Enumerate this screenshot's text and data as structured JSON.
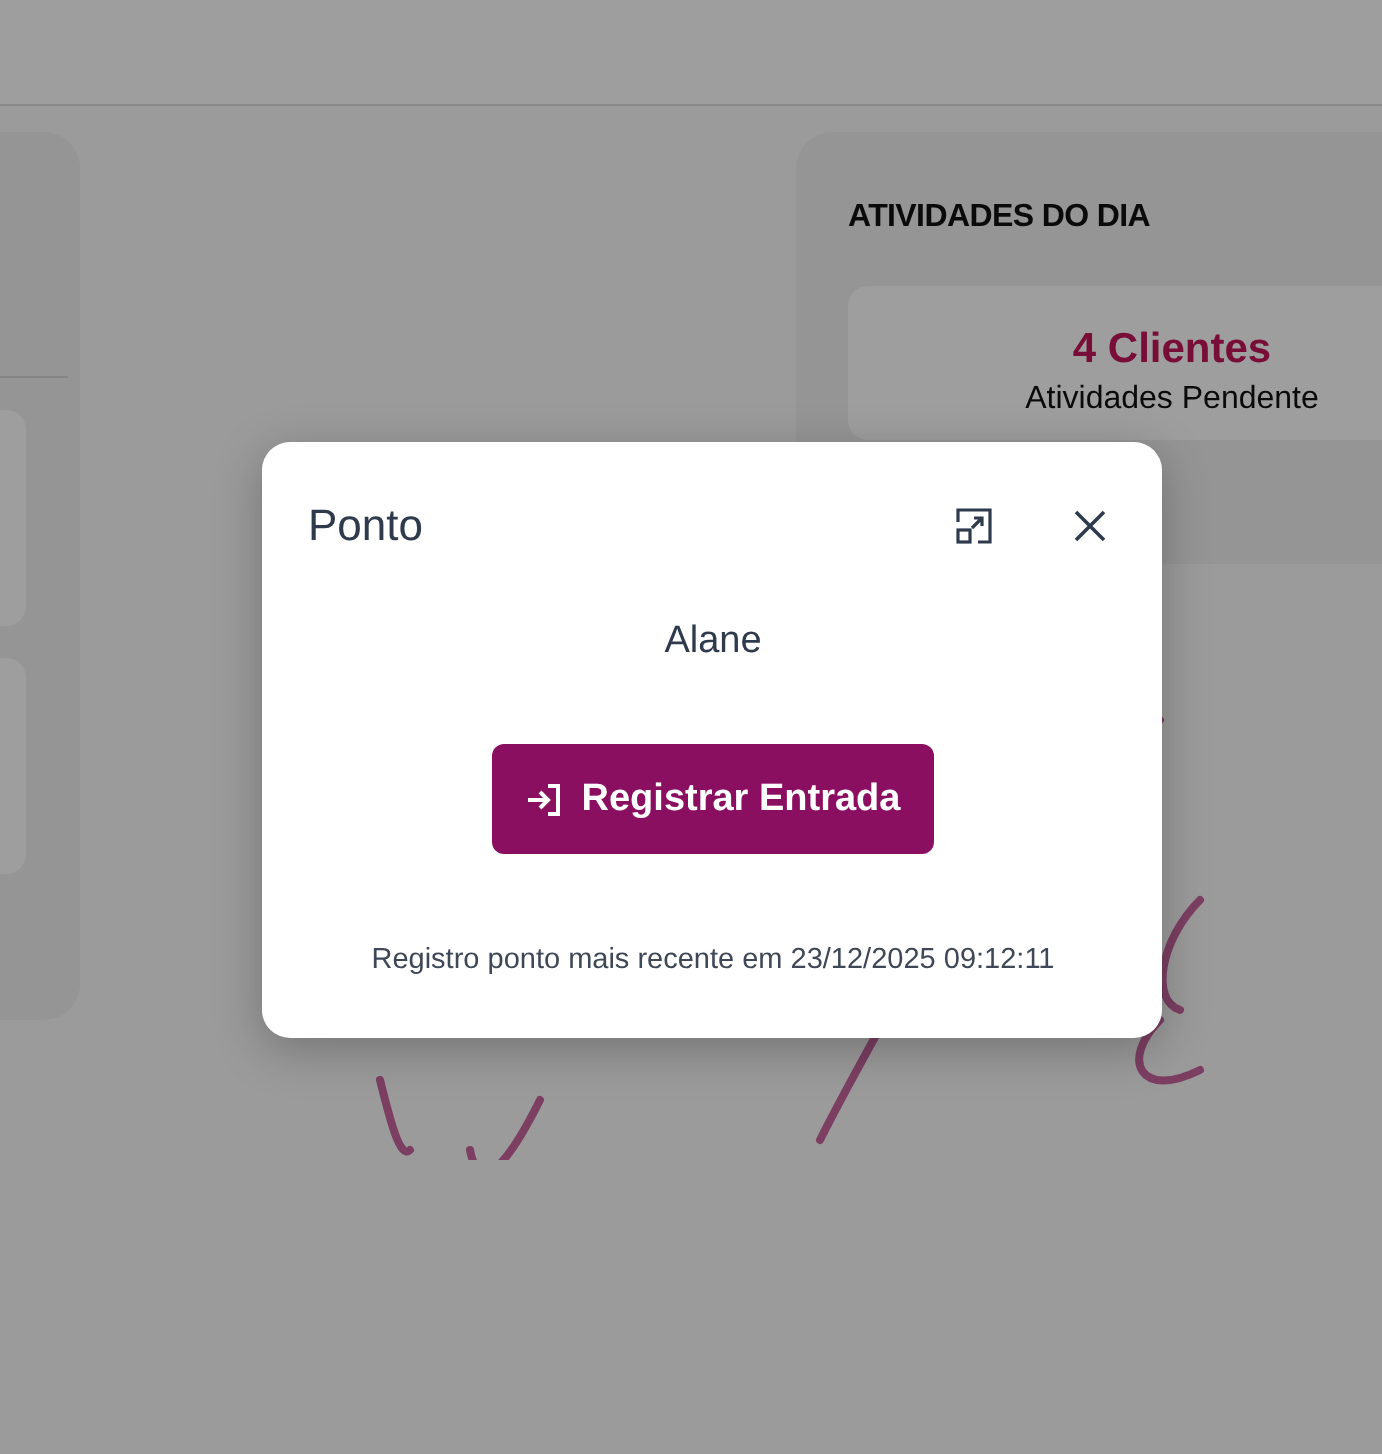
{
  "activities_card": {
    "title": "ATIVIDADES DO DIA",
    "count": "4 Clientes",
    "caption": "Atividades Pendente"
  },
  "dialog": {
    "title": "Ponto",
    "user": "Alane",
    "button": {
      "label": "Registrar Entrada"
    },
    "footer": "Registro ponto mais recente em 23/12/2025 09:12:11"
  }
}
